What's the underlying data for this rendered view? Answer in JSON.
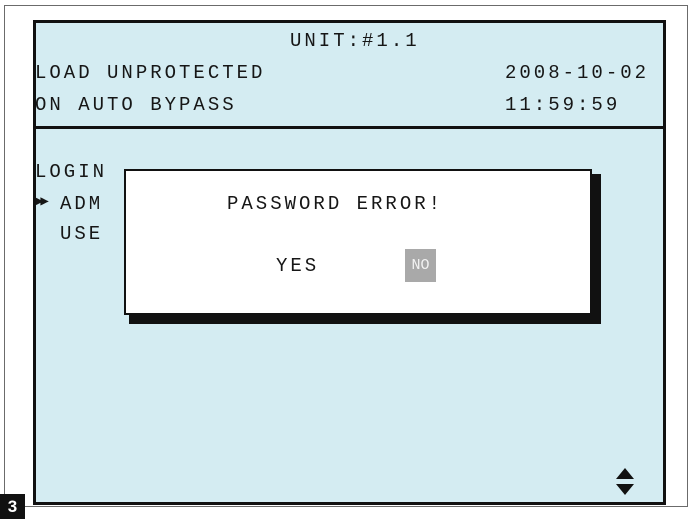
{
  "header": {
    "unit": "UNIT:#1.1",
    "status_line1": "LOAD UNPROTECTED",
    "status_line2": "ON AUTO BYPASS",
    "date": "2008-10-02",
    "time": "11:59:59"
  },
  "menu": {
    "title": "LOGIN",
    "items": [
      {
        "label": "ADM",
        "selected": true
      },
      {
        "label": "USE",
        "selected": false
      }
    ],
    "selection_marker": "▶▶"
  },
  "dialog": {
    "message": "PASSWORD ERROR!",
    "yes_label": "YES",
    "no_label": "NO",
    "highlighted_option": "NO"
  },
  "scroll_indicator_icon": "up-down-arrows-icon",
  "figure_number": "3",
  "colors": {
    "screen_background": "#d4ecf2",
    "highlight": "#a9a9a9",
    "text": "#161616"
  }
}
